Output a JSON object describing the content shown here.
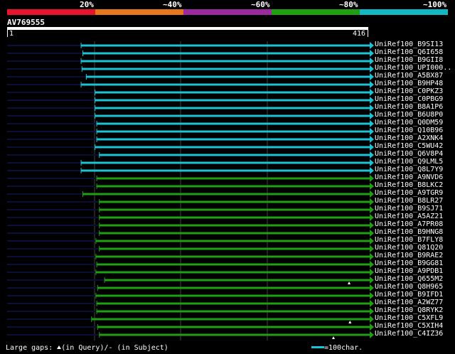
{
  "scale_labels": [
    "20%",
    "~40%",
    "~60%",
    "~80%",
    "~100%"
  ],
  "scale_colors": [
    "#e8142d",
    "#e8761a",
    "#9b2a9e",
    "#1ea012",
    "#12b8c4"
  ],
  "query": {
    "name": "AV769555",
    "start": "1",
    "end": "416"
  },
  "colors": {
    "cyan": "#1ac4d4",
    "green": "#1ea012",
    "dark": "#0a0f3a",
    "grid": "#444444"
  },
  "hits": [
    {
      "label": "UniRef100_B9SI13",
      "start": 86,
      "color": "cyan"
    },
    {
      "label": "UniRef100_Q6I658",
      "start": 88,
      "color": "cyan"
    },
    {
      "label": "UniRef100_B9GII8",
      "start": 86,
      "color": "cyan"
    },
    {
      "label": "UniRef100_UPI000..",
      "start": 87,
      "color": "cyan"
    },
    {
      "label": "UniRef100_A5BX87",
      "start": 92,
      "color": "cyan"
    },
    {
      "label": "UniRef100_B9HP48",
      "start": 86,
      "color": "cyan"
    },
    {
      "label": "UniRef100_C0PKZ3",
      "start": 102,
      "color": "cyan"
    },
    {
      "label": "UniRef100_C0PBG9",
      "start": 102,
      "color": "cyan"
    },
    {
      "label": "UniRef100_B8A1P6",
      "start": 102,
      "color": "cyan"
    },
    {
      "label": "UniRef100_B6U8P0",
      "start": 102,
      "color": "cyan"
    },
    {
      "label": "UniRef100_Q0DM59",
      "start": 104,
      "color": "cyan"
    },
    {
      "label": "UniRef100_Q10B96",
      "start": 104,
      "color": "cyan"
    },
    {
      "label": "UniRef100_A2XNK4",
      "start": 104,
      "color": "cyan"
    },
    {
      "label": "UniRef100_C5WU42",
      "start": 102,
      "color": "cyan"
    },
    {
      "label": "UniRef100_Q6V8P4",
      "start": 107,
      "color": "cyan"
    },
    {
      "label": "UniRef100_Q9LML5",
      "start": 86,
      "color": "cyan"
    },
    {
      "label": "UniRef100_Q8L7Y9",
      "start": 86,
      "color": "cyan"
    },
    {
      "label": "UniRef100_A9NVD6",
      "start": 104,
      "color": "green"
    },
    {
      "label": "UniRef100_B8LKC2",
      "start": 104,
      "color": "green"
    },
    {
      "label": "UniRef100_A9TGR9",
      "start": 88,
      "color": "green"
    },
    {
      "label": "UniRef100_B8LR27",
      "start": 107,
      "color": "green"
    },
    {
      "label": "UniRef100_B9SJ71",
      "start": 107,
      "color": "green"
    },
    {
      "label": "UniRef100_A5AZ21",
      "start": 107,
      "color": "green"
    },
    {
      "label": "UniRef100_A7PR08",
      "start": 107,
      "color": "green"
    },
    {
      "label": "UniRef100_B9HNG8",
      "start": 107,
      "color": "green"
    },
    {
      "label": "UniRef100_B7FLY8",
      "start": 103,
      "color": "green"
    },
    {
      "label": "UniRef100_Q81Q20",
      "start": 107,
      "color": "green"
    },
    {
      "label": "UniRef100_B9RAE2",
      "start": 103,
      "color": "green"
    },
    {
      "label": "UniRef100_B9GG81",
      "start": 104,
      "color": "green"
    },
    {
      "label": "UniRef100_A9PDB1",
      "start": 103,
      "color": "green"
    },
    {
      "label": "UniRef100_Q655M2",
      "start": 113,
      "color": "green",
      "gap": 394
    },
    {
      "label": "UniRef100_Q8H965",
      "start": 105,
      "color": "green"
    },
    {
      "label": "UniRef100_B9IFD1",
      "start": 103,
      "color": "green"
    },
    {
      "label": "UniRef100_A2WZ77",
      "start": 104,
      "color": "green"
    },
    {
      "label": "UniRef100_Q8RYK2",
      "start": 104,
      "color": "green"
    },
    {
      "label": "UniRef100_C5XFL9",
      "start": 98,
      "color": "green",
      "gap": 395
    },
    {
      "label": "UniRef100_C5XIH4",
      "start": 105,
      "color": "green"
    },
    {
      "label": "UniRef100_C4IZ36",
      "start": 107,
      "color": "green",
      "gap": 376
    }
  ],
  "legend": {
    "gaps_text": "Large gaps:",
    "query_text": "(in Query)/",
    "dash": "-",
    "subject_text": " (in Subject)",
    "scale_text": "=100char."
  }
}
